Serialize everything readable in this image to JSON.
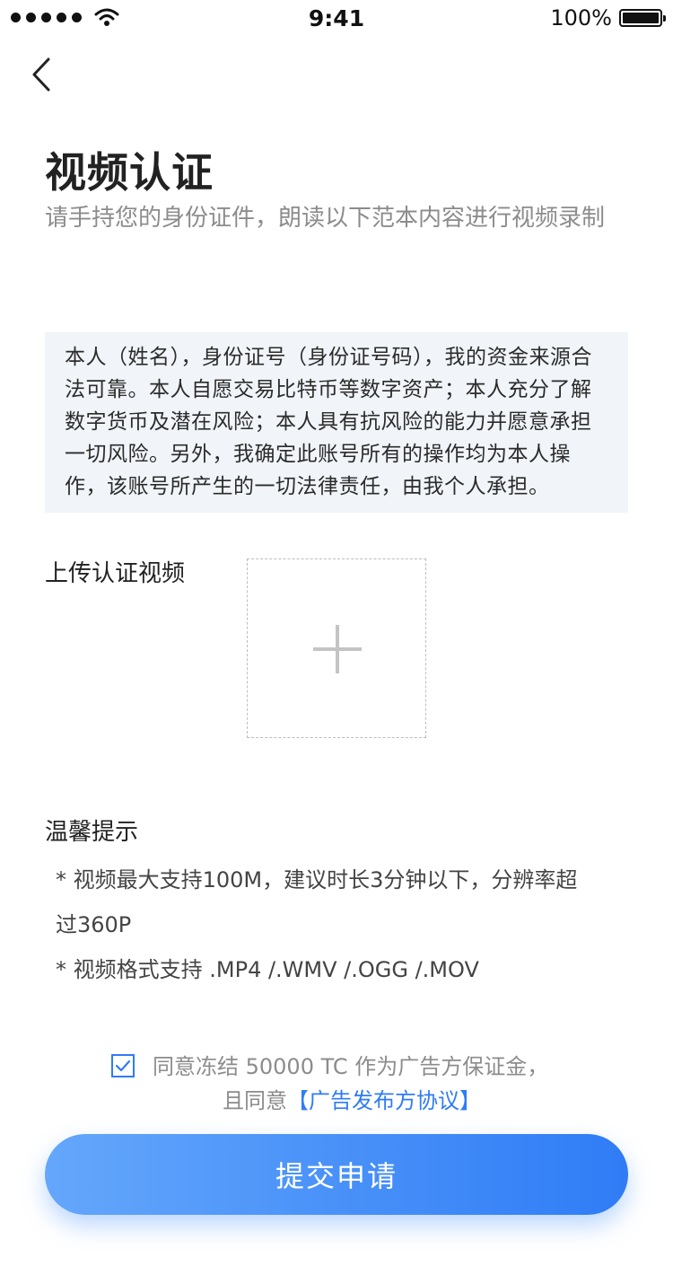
{
  "status_bar": {
    "time": "9:41",
    "battery_text": "100%"
  },
  "header": {
    "title": "视频认证",
    "subtitle": "请手持您的身份证件，朗读以下范本内容进行视频录制"
  },
  "script_text": "本人（姓名），身份证号（身份证号码），我的资金来源合法可靠。本人自愿交易比特币等数字资产；本人充分了解数字货币及潜在风险；本人具有抗风险的能力并愿意承担一切风险。另外，我确定此账号所有的操作均为本人操作，该账号所产生的一切法律责任，由我个人承担。",
  "upload": {
    "label": "上传认证视频"
  },
  "tips": {
    "title": "温馨提示",
    "lines": [
      "* 视频最大支持100M，建议时长3分钟以下，分辨率超",
      "过360P",
      "* 视频格式支持 .MP4 /.WMV /.OGG /.MOV"
    ]
  },
  "agreement": {
    "checked": true,
    "line1": "同意冻结 50000 TC 作为广告方保证金，",
    "line2_prefix": "且同意",
    "link": "【广告发布方协议】"
  },
  "submit_label": "提交申请",
  "colors": {
    "accent": "#2f7cf6",
    "script_bg": "#f1f4f9"
  }
}
